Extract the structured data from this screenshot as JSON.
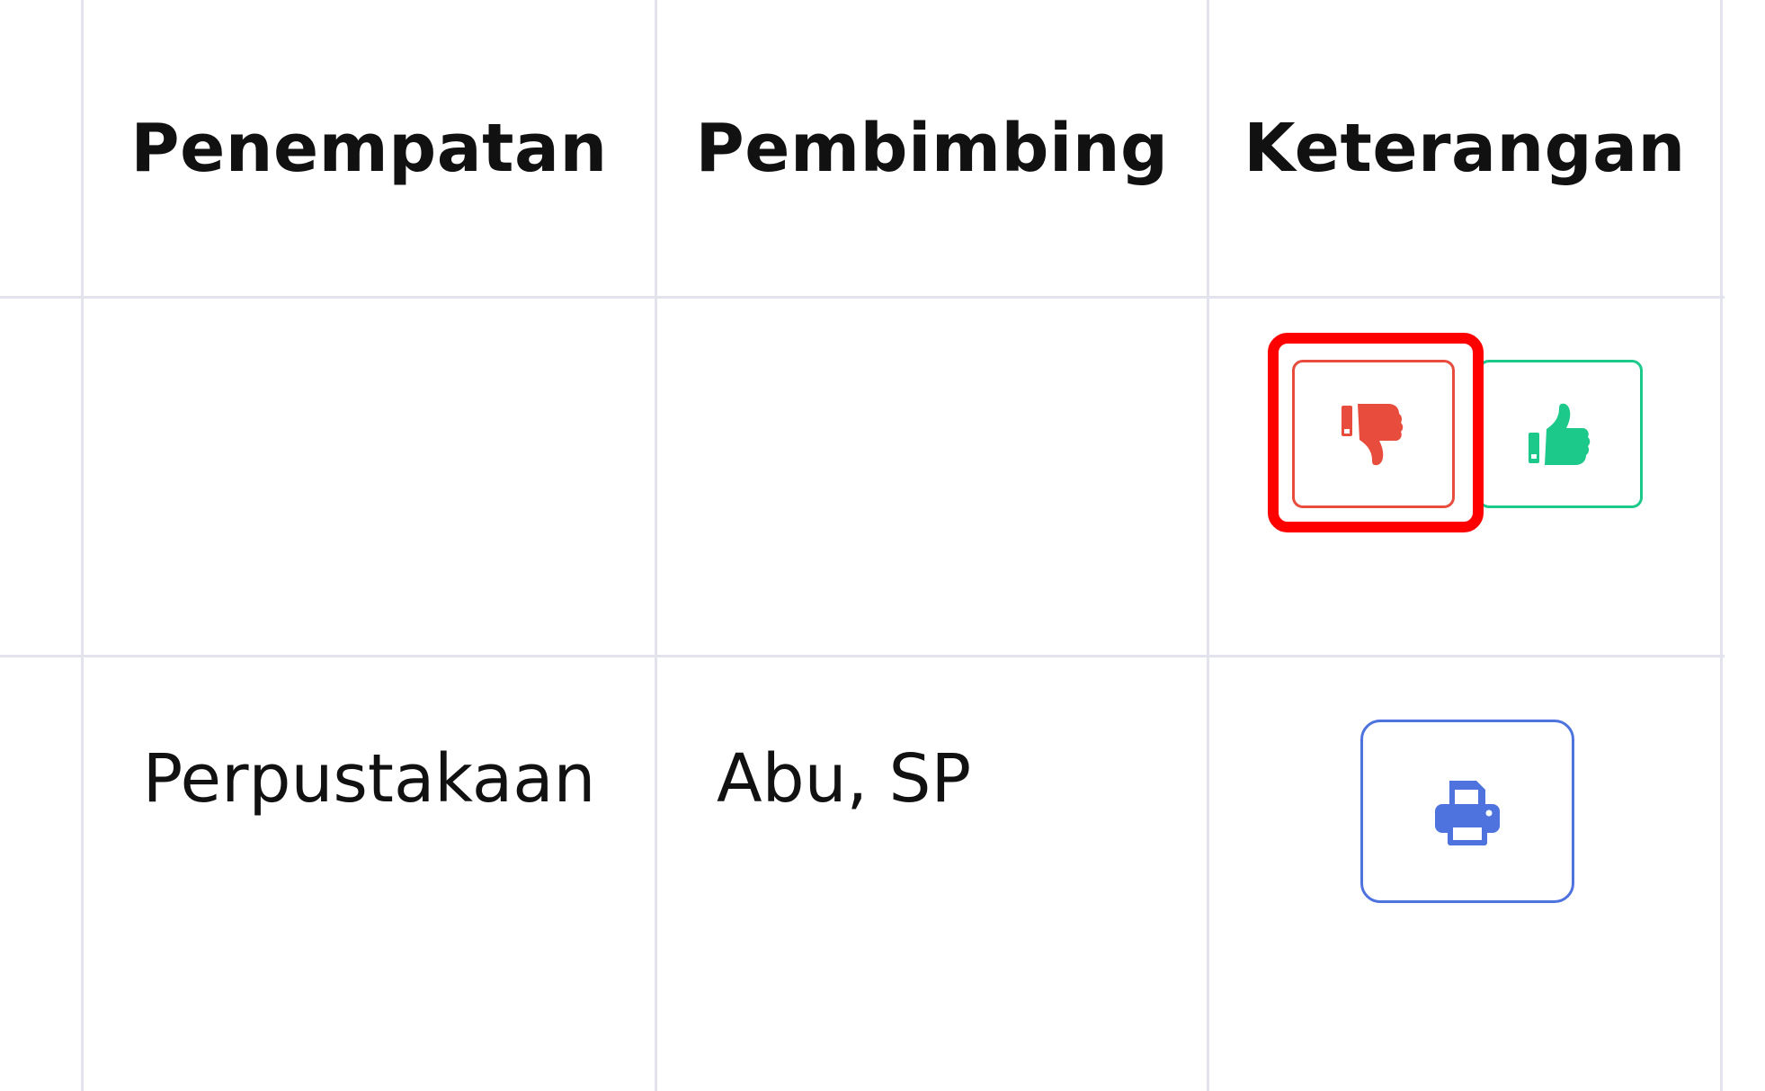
{
  "table": {
    "headers": [
      "Penempatan",
      "Pembimbing",
      "Keterangan"
    ],
    "rows": [
      {
        "penempatan": "",
        "pembimbing": "",
        "keterangan": {
          "actions": [
            {
              "name": "reject",
              "icon": "thumbs-down-icon",
              "color": "#e74c3c"
            },
            {
              "name": "approve",
              "icon": "thumbs-up-icon",
              "color": "#1cc88a"
            }
          ]
        }
      },
      {
        "penempatan": "Perpustakaan",
        "pembimbing": "Abu, SP",
        "keterangan": {
          "actions": [
            {
              "name": "print",
              "icon": "printer-icon",
              "color": "#4e73df"
            }
          ]
        }
      }
    ]
  },
  "colors": {
    "grid": "#e3e3ee",
    "text": "#111111",
    "reject": "#e74c3c",
    "approve": "#1cc88a",
    "print": "#4e73df",
    "highlight": "#ff0000"
  },
  "highlight": {
    "target": "reject-button"
  }
}
